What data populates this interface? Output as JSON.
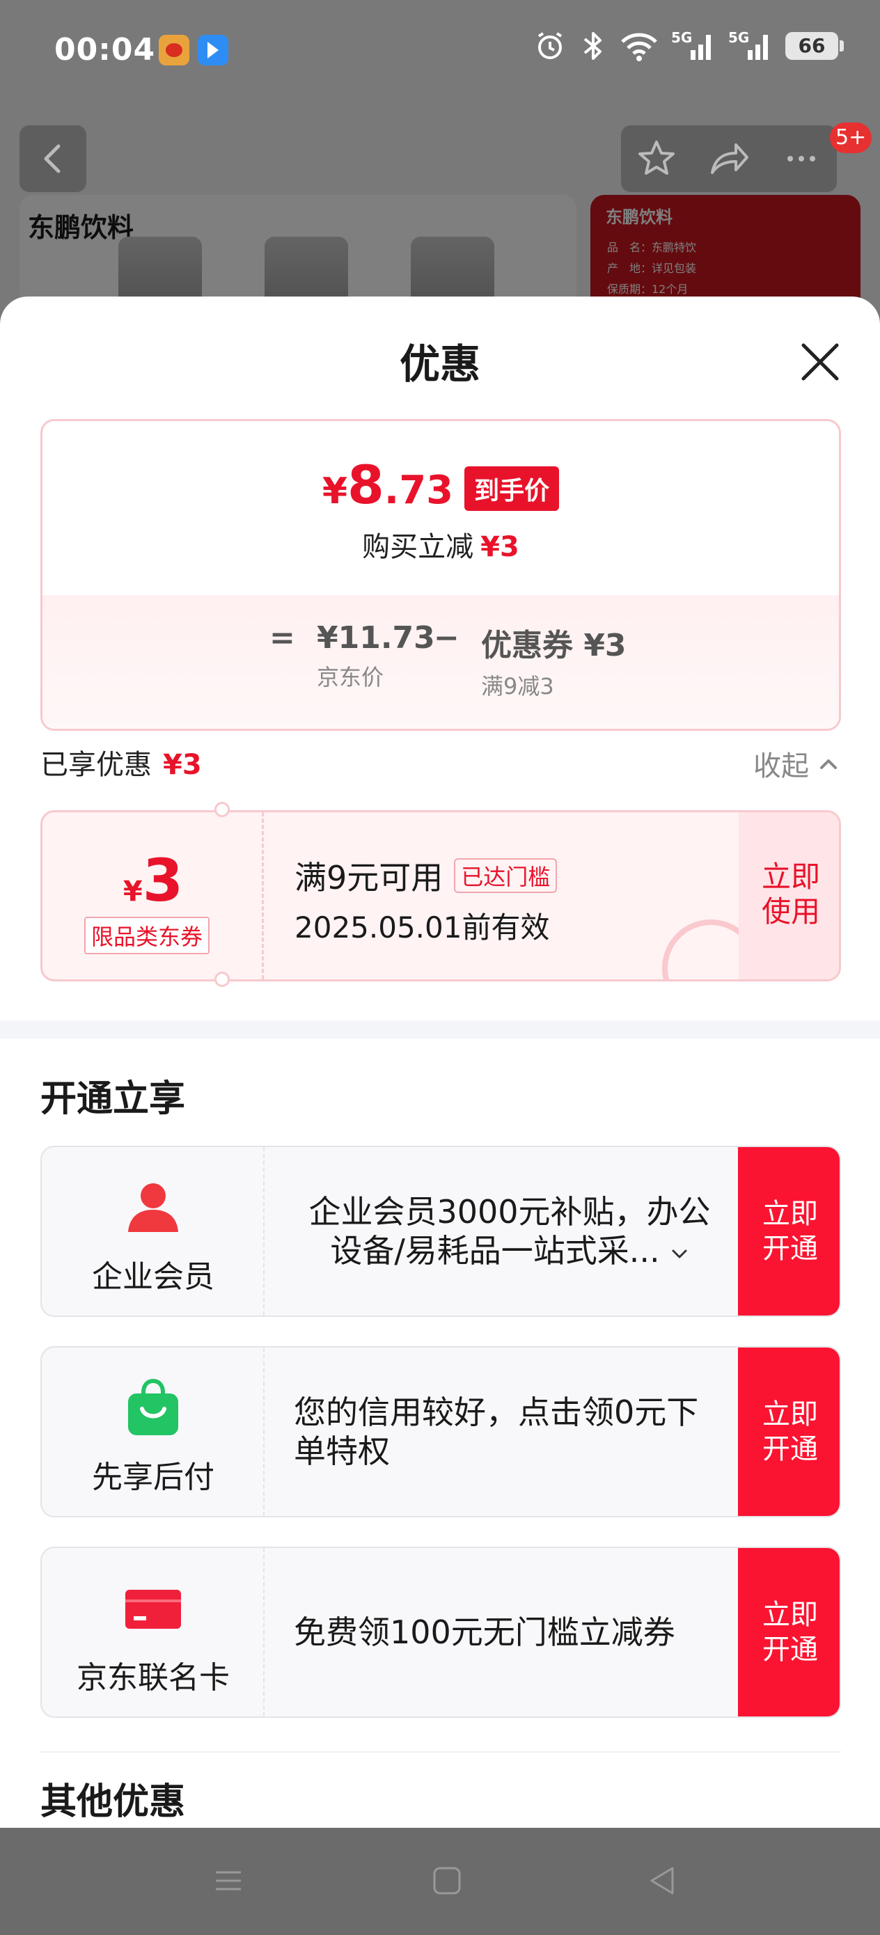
{
  "status_bar": {
    "time": "00:04",
    "battery": "66",
    "network_label": "5G"
  },
  "background": {
    "badge": "5+",
    "brand": "东鹏饮料",
    "right_brand": "东鹏饮料",
    "right_rows": [
      "品　名：东鹏特饮",
      "产　地：详见包装",
      "保质期：12个月"
    ]
  },
  "sheet": {
    "title": "优惠",
    "price": {
      "yen": "¥",
      "int": "8",
      "dec": ".73",
      "tag": "到手价",
      "sub_label": "购买立减",
      "sub_value": "¥3"
    },
    "calc": {
      "equals": "=",
      "jd_price": "¥11.73",
      "jd_price_label": "京东价",
      "minus": "−",
      "coupon": "优惠券 ¥3",
      "coupon_label": "满9减3"
    },
    "enjoyed": {
      "label": "已享优惠",
      "value": "¥3",
      "collapse": "收起"
    },
    "coupon": {
      "yen": "¥",
      "amount": "3",
      "type": "限品类东券",
      "condition": "满9元可用",
      "tag": "已达门槛",
      "valid": "2025.05.01前有效",
      "action": "立即使用"
    },
    "open_section": {
      "title": "开通立享",
      "items": [
        {
          "name": "企业会员",
          "desc": "企业会员3000元补贴，办公设备/易耗品一站式采...",
          "button": "立即开通",
          "icon": "person-icon",
          "color": "#f0383f"
        },
        {
          "name": "先享后付",
          "desc": "您的信用较好，点击领0元下单特权",
          "button": "立即开通",
          "icon": "shopping-bag-icon",
          "color": "#22c464"
        },
        {
          "name": "京东联名卡",
          "desc": "免费领100元无门槛立减券",
          "button": "立即开通",
          "icon": "credit-card-icon",
          "color": "#f0203a"
        }
      ]
    },
    "other_section": {
      "title": "其他优惠"
    }
  },
  "colors": {
    "accent": "#e8132a",
    "button": "#fa1431"
  }
}
